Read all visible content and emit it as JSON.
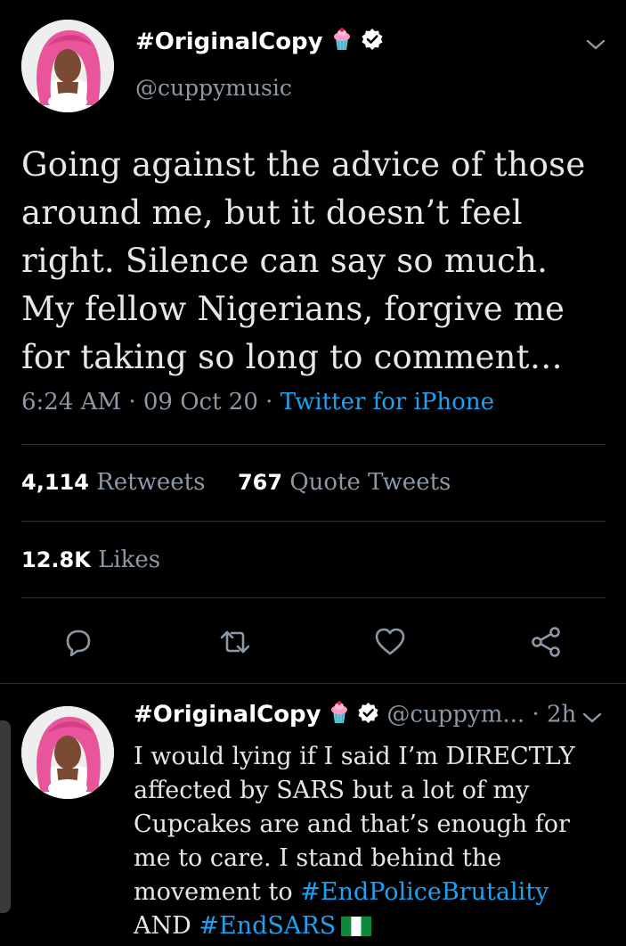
{
  "main_tweet": {
    "display_name": "#OriginalCopy",
    "handle": "@cuppymusic",
    "text": "Going against the advice of those around me, but it doesn’t feel right. Silence can say so much. My fellow Nigerians, forgive me for taking so long to comment…",
    "time": "6:24 AM",
    "date": "09 Oct 20",
    "source": "Twitter for iPhone",
    "dot": "·",
    "retweets_count": "4,114",
    "retweets_label": "Retweets",
    "quotes_count": "767",
    "quotes_label": "Quote Tweets",
    "likes_count": "12.8K",
    "likes_label": "Likes",
    "icons": [
      "cupcake-emoji",
      "verified-badge",
      "chevron-down-icon",
      "reply-icon",
      "retweet-icon",
      "like-icon",
      "share-icon"
    ]
  },
  "reply_tweet": {
    "display_name": "#OriginalCopy",
    "handle": "@cuppym...",
    "dot": "·",
    "age": "2h",
    "text_before": "I would lying if I said I’m DIRECTLY affected by SARS but a lot of my Cupcakes are and that’s enough for me to care. I stand behind the movement to ",
    "hashtag_1": "#EndPoliceBrutality",
    "and_word": " AND ",
    "hashtag_2": "#EndSARS",
    "flag": "nigeria-flag-emoji"
  },
  "colors": {
    "background": "#000000",
    "text": "#e7e7e7",
    "secondary": "#8b98a5",
    "accent": "#1da1f2",
    "divider": "#2f3336",
    "avatar_hair": "#e8559a"
  }
}
